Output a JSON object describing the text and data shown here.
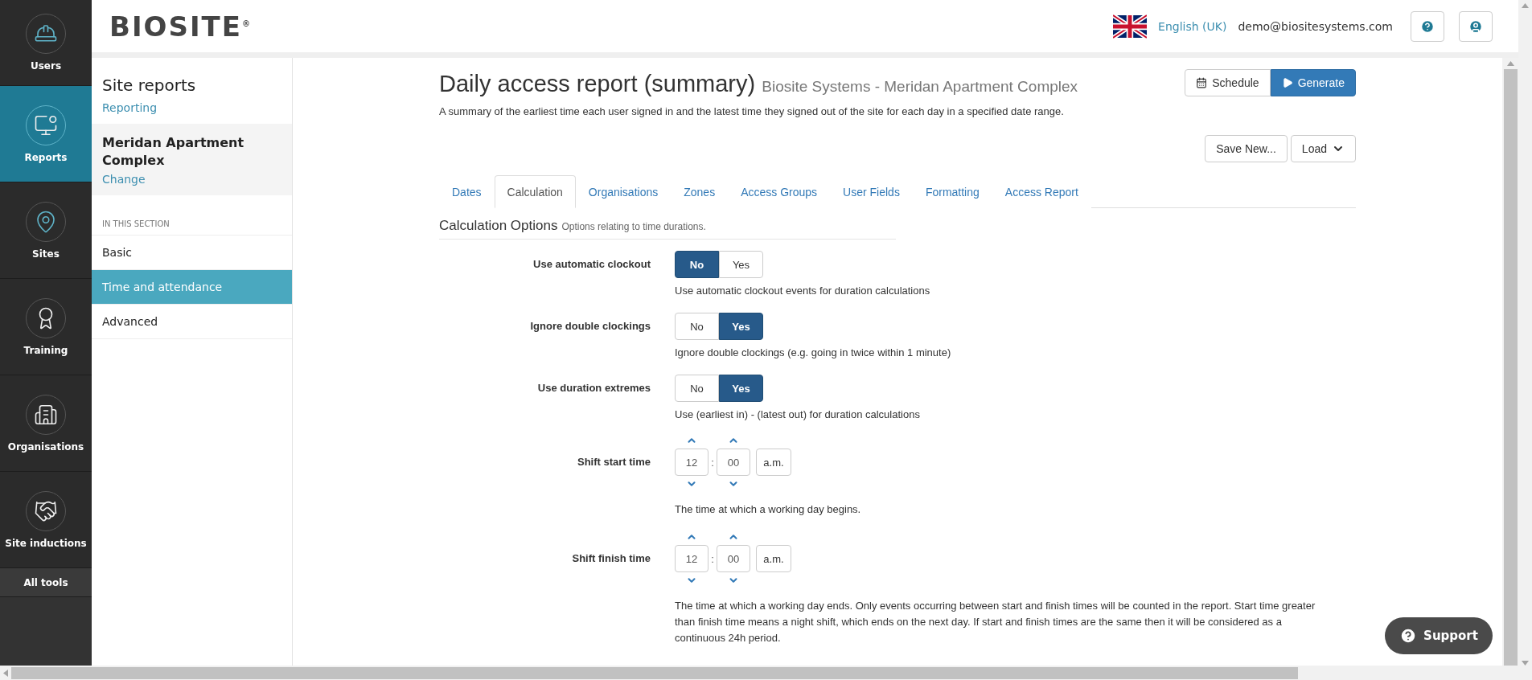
{
  "rail": [
    {
      "label": "Users",
      "selected": false
    },
    {
      "label": "Reports",
      "selected": true
    },
    {
      "label": "Sites",
      "selected": false
    },
    {
      "label": "Training",
      "selected": false
    },
    {
      "label": "Organisations",
      "selected": false
    },
    {
      "label": "Site inductions",
      "selected": false
    }
  ],
  "all_tools": "All tools",
  "header": {
    "logo": "BIOSITE",
    "logo_mark": "®",
    "language": "English (UK)",
    "email": "demo@biositesystems.com"
  },
  "sidebar": {
    "title": "Site reports",
    "link": "Reporting",
    "site": {
      "name": "Meridan Apartment Complex",
      "action": "Change"
    },
    "section_heading": "IN THIS SECTION",
    "items": [
      {
        "label": "Basic",
        "selected": false
      },
      {
        "label": "Time and attendance",
        "selected": true
      },
      {
        "label": "Advanced",
        "selected": false
      }
    ]
  },
  "report": {
    "title": "Daily access report (summary)",
    "subtitle": "Biosite Systems - Meridan Apartment Complex",
    "description": "A summary of the earliest time each user signed in and the latest time they signed out of the site for each day in a specified date range.",
    "actions": [
      {
        "label": "Schedule",
        "kind": "schedule"
      },
      {
        "label": "Generate",
        "kind": "generate"
      }
    ],
    "save_actions": [
      {
        "label": "Save New...",
        "kind": "save"
      },
      {
        "label": "Load",
        "kind": "load"
      }
    ]
  },
  "tabs": [
    {
      "label": "Dates",
      "selected": false
    },
    {
      "label": "Calculation",
      "selected": true
    },
    {
      "label": "Organisations",
      "selected": false
    },
    {
      "label": "Zones",
      "selected": false
    },
    {
      "label": "Access Groups",
      "selected": false
    },
    {
      "label": "User Fields",
      "selected": false
    },
    {
      "label": "Formatting",
      "selected": false
    },
    {
      "label": "Access Report",
      "selected": false
    }
  ],
  "options": {
    "heading": "Calculation Options",
    "hint": "Options relating to time durations."
  },
  "fields": [
    {
      "kind": "toggle",
      "label": "Use automatic clockout",
      "options": [
        {
          "label": "No",
          "selected": true
        },
        {
          "label": "Yes",
          "selected": false
        }
      ],
      "help": "Use automatic clockout events for duration calculations"
    },
    {
      "kind": "toggle",
      "label": "Ignore double clockings",
      "options": [
        {
          "label": "No",
          "selected": false
        },
        {
          "label": "Yes",
          "selected": true
        }
      ],
      "help": "Ignore double clockings (e.g. going in twice within 1 minute)"
    },
    {
      "kind": "toggle",
      "label": "Use duration extremes",
      "options": [
        {
          "label": "No",
          "selected": false
        },
        {
          "label": "Yes",
          "selected": true
        }
      ],
      "help": "Use (earliest in) - (latest out) for duration calculations"
    },
    {
      "kind": "time",
      "label": "Shift start time",
      "hour": "12",
      "separator": ":",
      "minute": "00",
      "period": "a.m.",
      "help": "The time at which a working day begins."
    },
    {
      "kind": "time",
      "label": "Shift finish time",
      "hour": "12",
      "separator": ":",
      "minute": "00",
      "period": "a.m.",
      "help": "The time at which a working day ends. Only events occurring between start and finish times will be counted in the report. Start time greater than finish time means a night shift, which ends on the next day. If start and finish times are the same then it will be considered as a continuous 24h period."
    }
  ],
  "support": "Support"
}
